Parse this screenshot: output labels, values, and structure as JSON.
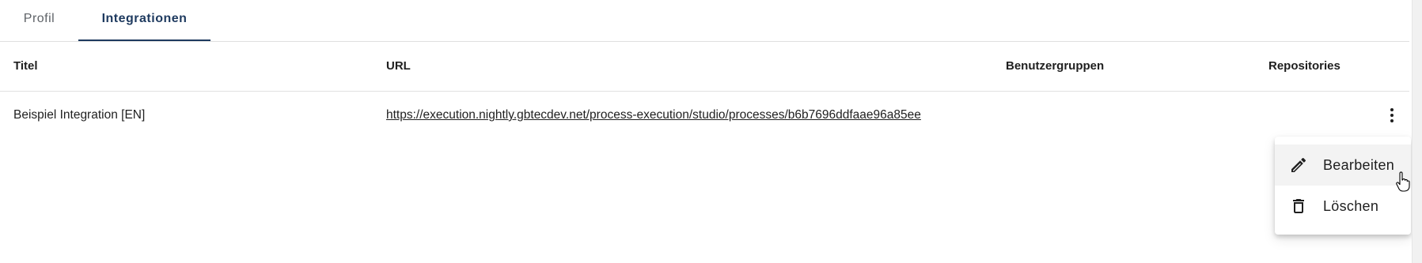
{
  "tabs": [
    {
      "label": "Profil",
      "active": false
    },
    {
      "label": "Integrationen",
      "active": true
    }
  ],
  "table": {
    "headers": {
      "title": "Titel",
      "url": "URL",
      "groups": "Benutzergruppen",
      "repositories": "Repositories"
    },
    "rows": [
      {
        "title": "Beispiel Integration [EN]",
        "url": "https://execution.nightly.gbtecdev.net/process-execution/studio/processes/b6b7696ddfaae96a85ee",
        "groups": "",
        "repositories": ""
      }
    ]
  },
  "context_menu": {
    "items": [
      {
        "label": "Bearbeiten",
        "icon": "pencil-icon"
      },
      {
        "label": "Löschen",
        "icon": "trash-icon"
      }
    ]
  },
  "colors": {
    "accent": "#1e3a5f",
    "divider": "#e0e0e0",
    "menu_hover": "#f3f3f3"
  }
}
